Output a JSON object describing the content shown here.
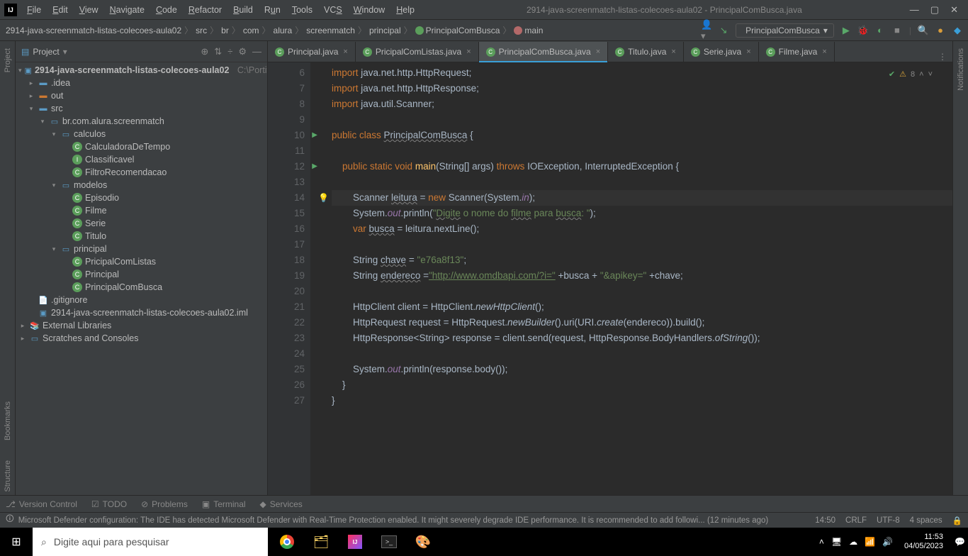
{
  "window": {
    "title": "2914-java-screenmatch-listas-colecoes-aula02 - PrincipalComBusca.java",
    "menus": [
      "File",
      "Edit",
      "View",
      "Navigate",
      "Code",
      "Refactor",
      "Build",
      "Run",
      "Tools",
      "VCS",
      "Window",
      "Help"
    ]
  },
  "breadcrumb": {
    "items": [
      "2914-java-screenmatch-listas-colecoes-aula02",
      "src",
      "br",
      "com",
      "alura",
      "screenmatch",
      "principal",
      "PrincipalComBusca",
      "main"
    ]
  },
  "runConfig": "PrincipalComBusca",
  "projectPanel": {
    "title": "Project",
    "root": "2914-java-screenmatch-listas-colecoes-aula02",
    "rootPath": "C:\\Portifo"
  },
  "tree": {
    "idea": ".idea",
    "out": "out",
    "src": "src",
    "pkg": "br.com.alura.screenmatch",
    "calculos": "calculos",
    "calc1": "CalculadoraDeTempo",
    "calc2": "Classificavel",
    "calc3": "FiltroRecomendacao",
    "modelos": "modelos",
    "mod1": "Episodio",
    "mod2": "Filme",
    "mod3": "Serie",
    "mod4": "Titulo",
    "principal": "principal",
    "p1": "PricipalComListas",
    "p2": "Principal",
    "p3": "PrincipalComBusca",
    "gitignore": ".gitignore",
    "iml": "2914-java-screenmatch-listas-colecoes-aula02.iml",
    "extlib": "External Libraries",
    "scratch": "Scratches and Consoles"
  },
  "tabs": [
    {
      "label": "Principal.java"
    },
    {
      "label": "PricipalComListas.java"
    },
    {
      "label": "PrincipalComBusca.java",
      "active": true
    },
    {
      "label": "Titulo.java"
    },
    {
      "label": "Serie.java"
    },
    {
      "label": "Filme.java"
    }
  ],
  "inspection": {
    "warnings": "8"
  },
  "code": {
    "startLine": 6,
    "lines": [
      {
        "n": 6,
        "html": "<span class='kw'>import</span> java.net.http.HttpRequest;"
      },
      {
        "n": 7,
        "html": "<span class='kw'>import</span> java.net.http.HttpResponse;"
      },
      {
        "n": 8,
        "html": "<span class='kw'>import</span> java.util.Scanner;"
      },
      {
        "n": 9,
        "html": ""
      },
      {
        "n": 10,
        "html": "<span class='kw'>public class</span> <span class='wavy'>PrincipalComBusca</span> {",
        "run": true
      },
      {
        "n": 11,
        "html": ""
      },
      {
        "n": 12,
        "html": "    <span class='kw'>public static void</span> <span style='color:#ffc66d'>main</span>(String[] args) <span class='kw'>throws</span> IOException, InterruptedException {",
        "run": true
      },
      {
        "n": 13,
        "html": ""
      },
      {
        "n": 14,
        "html": "        Scanner <span class='wavy'>leitura</span> = <span class='kw'>new</span> Scanner(System.<span class='fld'>in</span>);",
        "hl": true,
        "bulb": true
      },
      {
        "n": 15,
        "html": "        System.<span class='fld'>out</span>.println(<span class='str'>\"<span class='wavy'>Digite</span> o nome do <span class='wavy'>filme</span> para <span class='wavy'>busca</span>: \"</span>);"
      },
      {
        "n": 16,
        "html": "        <span class='kw'>var</span> <span class='wavy'>busca</span> = leitura.nextLine();"
      },
      {
        "n": 17,
        "html": ""
      },
      {
        "n": 18,
        "html": "        String <span class='wavy'>chave</span> = <span class='str'>\"e76a8f13\"</span>;"
      },
      {
        "n": 19,
        "html": "        String <span class='wavy'>endereco</span> =<span class='url'>\"http://www.omdbapi.com/?i=\"</span> +busca + <span class='str'>\"&amp;apikey=\"</span> +chave;"
      },
      {
        "n": 20,
        "html": ""
      },
      {
        "n": 21,
        "html": "        HttpClient client = HttpClient.<span class='mstat'>newHttpClient</span>();"
      },
      {
        "n": 22,
        "html": "        HttpRequest request = HttpRequest.<span class='mstat'>newBuilder</span>().uri(URI.<span class='mstat'>create</span>(endereco)).build();"
      },
      {
        "n": 23,
        "html": "        HttpResponse&lt;String&gt; response = client.send(request, HttpResponse.BodyHandlers.<span class='mstat'>ofString</span>());"
      },
      {
        "n": 24,
        "html": ""
      },
      {
        "n": 25,
        "html": "        System.<span class='fld'>out</span>.println(response.body());"
      },
      {
        "n": 26,
        "html": "    }"
      },
      {
        "n": 27,
        "html": "}"
      }
    ]
  },
  "toolWindows": {
    "vc": "Version Control",
    "todo": "TODO",
    "problems": "Problems",
    "terminal": "Terminal",
    "services": "Services"
  },
  "rails": {
    "project": "Project",
    "bookmarks": "Bookmarks",
    "structure": "Structure",
    "notifications": "Notifications"
  },
  "status": {
    "msg": "Microsoft Defender configuration: The IDE has detected Microsoft Defender with Real-Time Protection enabled. It might severely degrade IDE performance. It is recommended to add followi... (12 minutes ago)",
    "pos": "14:50",
    "eol": "CRLF",
    "enc": "UTF-8",
    "indent": "4 spaces"
  },
  "taskbar": {
    "searchPlaceholder": "Digite aqui para pesquisar",
    "time": "11:53",
    "date": "04/05/2023"
  }
}
